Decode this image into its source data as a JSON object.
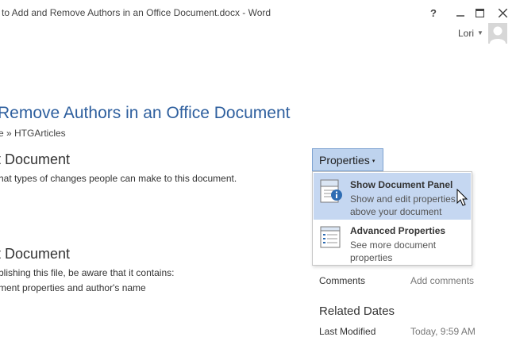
{
  "window": {
    "title": "to Add and Remove Authors in an Office Document.docx - Word",
    "help": "?",
    "minimize": "🗕",
    "maximize": "☐",
    "close": "✕"
  },
  "user": {
    "name": "Lori"
  },
  "document": {
    "title": "Remove Authors in an Office Document",
    "breadcrumb": "e » HTGArticles"
  },
  "sections": [
    {
      "heading": "t Document",
      "lines": [
        "hat types of changes people can make to this document."
      ]
    },
    {
      "heading": "t Document",
      "lines": [
        "blishing this file, be aware that it contains:",
        "ment properties and author's name"
      ]
    }
  ],
  "properties_button": {
    "label": "Properties",
    "caret": "▾"
  },
  "menu": {
    "items": [
      {
        "title": "Show Document Panel",
        "desc": "Show and edit properties above your document",
        "icon": "document-panel-icon"
      },
      {
        "title": "Advanced Properties",
        "desc": "See more document properties",
        "icon": "properties-list-icon"
      }
    ]
  },
  "properties": {
    "comments_label": "Comments",
    "comments_value": "Add comments",
    "related_dates_heading": "Related Dates",
    "last_modified_label": "Last Modified",
    "last_modified_value": "Today, 9:59 AM"
  },
  "colors": {
    "accent": "#2e5f9e",
    "menu_highlight": "#c5d7f1",
    "button_bg": "#bed3ee"
  }
}
